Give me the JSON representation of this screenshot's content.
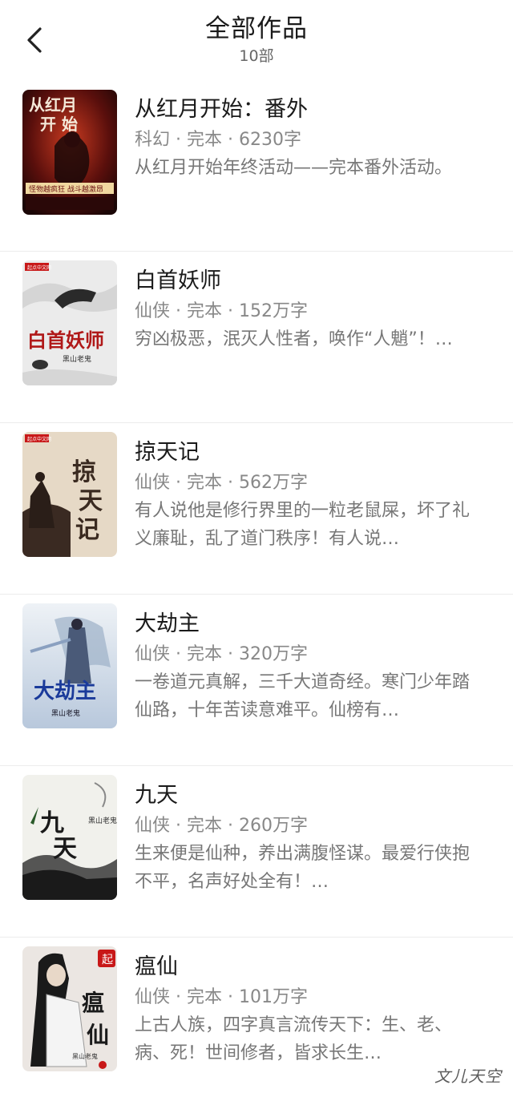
{
  "header": {
    "title": "全部作品",
    "count": "10部"
  },
  "books": [
    {
      "title": "从红月开始：番外",
      "meta": "科幻 · 完本 · 6230字",
      "desc": "从红月开始年终活动——完本番外活动。",
      "cover_text": "从红月开始",
      "cover_tagline": "怪物越疯狂 战斗越激昂",
      "colors": {
        "bg": "#5a1010",
        "accent": "#e03020"
      }
    },
    {
      "title": "白首妖师",
      "meta": "仙侠 · 完本 · 152万字",
      "desc": "穷凶极恶，泯灭人性者，唤作“人魈”！…",
      "cover_text": "白首妖师",
      "cover_author": "黑山老鬼",
      "cover_badge": "起点中文网",
      "colors": {
        "bg": "#ececec",
        "accent": "#b01818"
      }
    },
    {
      "title": "掠天记",
      "meta": "仙侠 · 完本 · 562万字",
      "desc": "有人说他是修行界里的一粒老鼠屎，坏了礼义廉耻，乱了道门秩序！有人说…",
      "cover_text": "掠天记",
      "cover_badge": "起点中文网",
      "colors": {
        "bg": "#e8dccb",
        "accent": "#3a2a20"
      }
    },
    {
      "title": "大劫主",
      "meta": "仙侠 · 完本 · 320万字",
      "desc": "一卷道元真解，三千大道奇经。寒门少年踏仙路，十年苦读意难平。仙榜有…",
      "cover_text": "大劫主",
      "cover_author": "黑山老鬼",
      "colors": {
        "bg": "#d8e2ee",
        "accent": "#1a3a9a"
      }
    },
    {
      "title": "九天",
      "meta": "仙侠 · 完本 · 260万字",
      "desc": "生来便是仙种，养出满腹怪谋。最爱行侠抱不平，名声好处全有！…",
      "cover_text": "九天",
      "cover_author": "黑山老鬼",
      "colors": {
        "bg": "#f2f2ee",
        "accent": "#1a1a1a"
      }
    },
    {
      "title": "瘟仙",
      "meta": "仙侠 · 完本 · 101万字",
      "desc": "上古人族，四字真言流传天下：生、老、病、死！世间修者，皆求长生…",
      "cover_text": "瘟仙",
      "cover_author": "黑山老鬼",
      "cover_badge": "起",
      "colors": {
        "bg": "#ece8e4",
        "accent": "#c01818"
      }
    }
  ],
  "watermark": "文儿天空"
}
